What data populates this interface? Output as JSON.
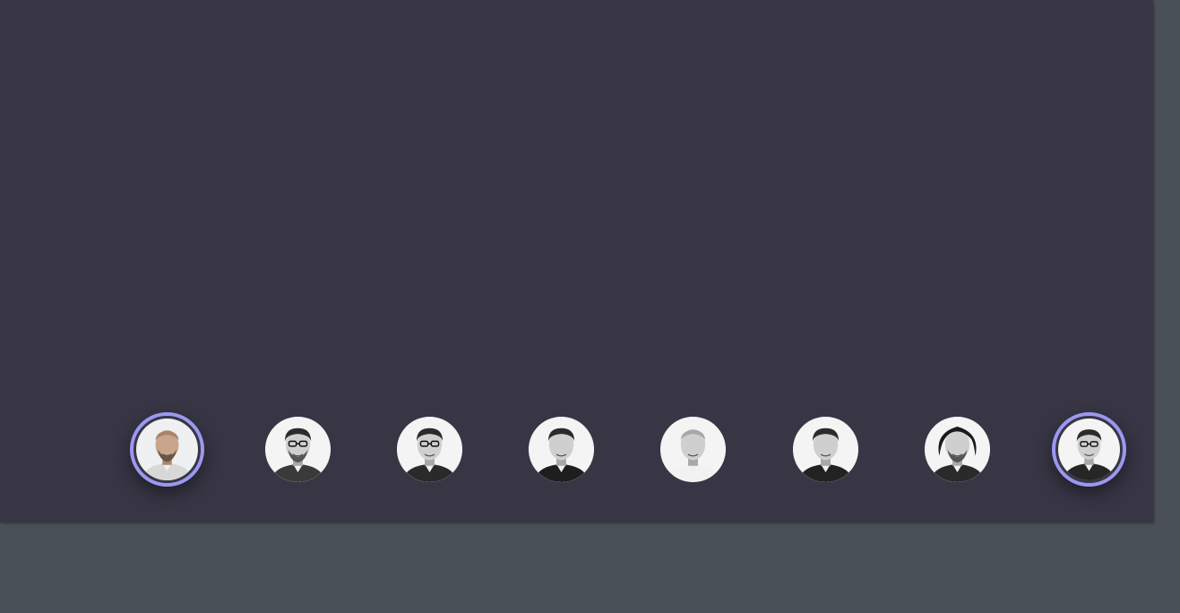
{
  "carousel": {
    "avatars": [
      {
        "id": "person-1",
        "selected": true,
        "tone": "color",
        "hair": "bald",
        "shirt": "#d8d8d8",
        "beard": true,
        "glasses": false
      },
      {
        "id": "person-2",
        "selected": false,
        "tone": "mono",
        "hair": "short",
        "shirt": "#3a3a3a",
        "beard": true,
        "glasses": true
      },
      {
        "id": "person-3",
        "selected": false,
        "tone": "mono",
        "hair": "short",
        "shirt": "#2a2a2a",
        "beard": false,
        "glasses": true
      },
      {
        "id": "person-4",
        "selected": false,
        "tone": "mono",
        "hair": "short",
        "shirt": "#1e1e1e",
        "beard": false,
        "glasses": false
      },
      {
        "id": "person-5",
        "selected": false,
        "tone": "mono",
        "hair": "bald",
        "shirt": "#f2f2f2",
        "beard": false,
        "glasses": false
      },
      {
        "id": "person-6",
        "selected": false,
        "tone": "mono",
        "hair": "short",
        "shirt": "#222222",
        "beard": false,
        "glasses": false
      },
      {
        "id": "person-7",
        "selected": false,
        "tone": "mono",
        "hair": "curly",
        "shirt": "#2a2a2a",
        "beard": true,
        "glasses": false
      },
      {
        "id": "person-8",
        "selected": true,
        "tone": "mono",
        "hair": "short",
        "shirt": "#262626",
        "beard": false,
        "glasses": true
      }
    ]
  },
  "colors": {
    "page_background": "#4a5058",
    "panel_background": "#383645",
    "selected_ring": "#9b98f0"
  }
}
